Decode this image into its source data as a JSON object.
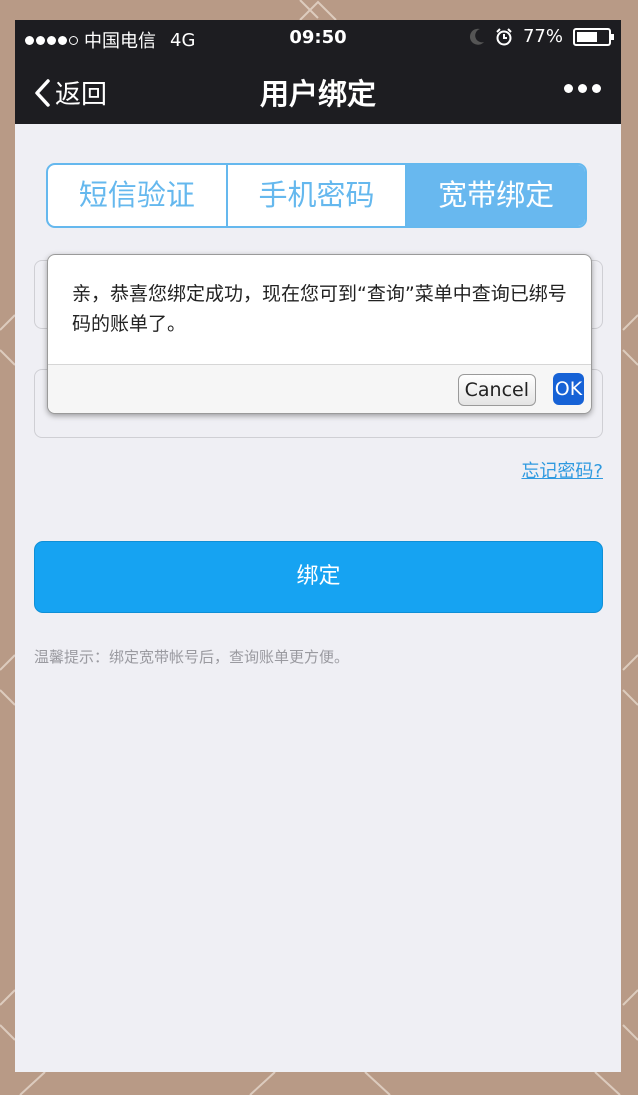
{
  "status_bar": {
    "carrier": "中国电信",
    "network": "4G",
    "time": "09:50",
    "battery": "77%",
    "battery_level": 0.77
  },
  "nav": {
    "back_label": "返回",
    "title": "用户绑定"
  },
  "tabs": [
    {
      "label": "短信验证",
      "active": false
    },
    {
      "label": "手机密码",
      "active": false
    },
    {
      "label": "宽带绑定",
      "active": true
    }
  ],
  "form": {
    "forgot_password": "忘记密码?",
    "bind_button": "绑定",
    "hint": "温馨提示：绑定宽带帐号后，查询账单更方便。"
  },
  "dialog": {
    "message": "亲，恭喜您绑定成功，现在您可到“查询”菜单中查询已绑号码的账单了。",
    "cancel_label": "Cancel",
    "ok_label": "OK"
  }
}
